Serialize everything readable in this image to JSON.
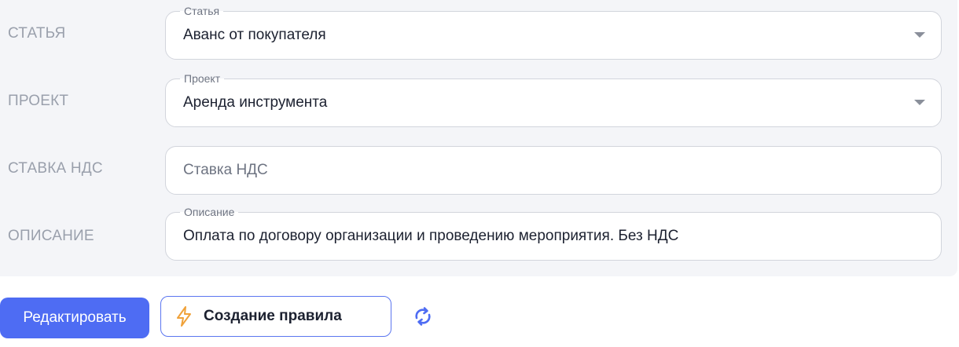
{
  "form": {
    "rows": [
      {
        "label": "СТАТЬЯ",
        "legend": "Статья",
        "value": "Аванс от покупателя",
        "type": "select"
      },
      {
        "label": "ПРОЕКТ",
        "legend": "Проект",
        "value": "Аренда инструмента",
        "type": "select"
      },
      {
        "label": "СТАВКА НДС",
        "placeholder": "Ставка НДС",
        "type": "input"
      },
      {
        "label": "ОПИСАНИЕ",
        "legend": "Описание",
        "value": "Оплата по договору организации и проведению мероприятия. Без НДС",
        "type": "input"
      }
    ]
  },
  "actions": {
    "edit_label": "Редактировать",
    "rule_label": "Создание правила",
    "rule_icon": "lightning-icon",
    "refresh_icon": "refresh-icon"
  },
  "colors": {
    "accent": "#4e6cf3",
    "bolt": "#f0a23a",
    "panel_bg": "#f4f5f8"
  }
}
